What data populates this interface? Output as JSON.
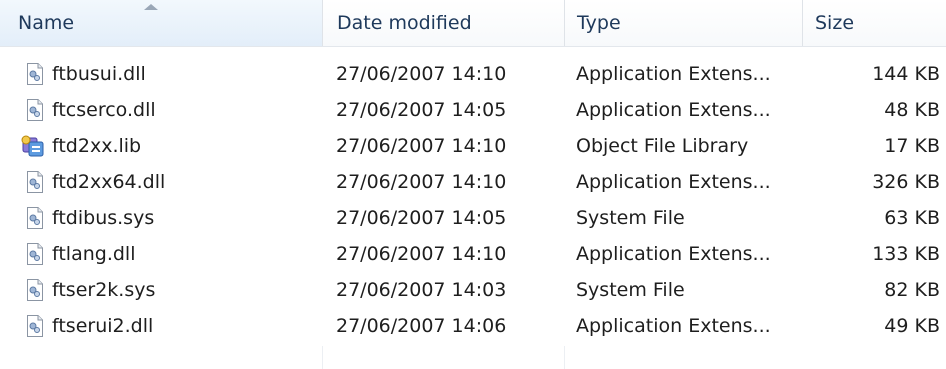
{
  "columns": {
    "name": "Name",
    "date": "Date modified",
    "type": "Type",
    "size": "Size"
  },
  "files": [
    {
      "name": "ftbusui.dll",
      "date": "27/06/2007 14:10",
      "type": "Application Extens...",
      "size": "144 KB",
      "icon": "dll-file-icon"
    },
    {
      "name": "ftcserco.dll",
      "date": "27/06/2007 14:05",
      "type": "Application Extens...",
      "size": "48 KB",
      "icon": "dll-file-icon"
    },
    {
      "name": "ftd2xx.lib",
      "date": "27/06/2007 14:10",
      "type": "Object File Library",
      "size": "17 KB",
      "icon": "lib-file-icon"
    },
    {
      "name": "ftd2xx64.dll",
      "date": "27/06/2007 14:10",
      "type": "Application Extens...",
      "size": "326 KB",
      "icon": "dll-file-icon"
    },
    {
      "name": "ftdibus.sys",
      "date": "27/06/2007 14:05",
      "type": "System File",
      "size": "63 KB",
      "icon": "sys-file-icon"
    },
    {
      "name": "ftlang.dll",
      "date": "27/06/2007 14:10",
      "type": "Application Extens...",
      "size": "133 KB",
      "icon": "dll-file-icon"
    },
    {
      "name": "ftser2k.sys",
      "date": "27/06/2007 14:03",
      "type": "System File",
      "size": "82 KB",
      "icon": "sys-file-icon"
    },
    {
      "name": "ftserui2.dll",
      "date": "27/06/2007 14:06",
      "type": "Application Extens...",
      "size": "49 KB",
      "icon": "dll-file-icon"
    }
  ],
  "colors": {
    "header_text": "#1e395b",
    "row_text": "#1e1e1e",
    "sorted_header_bg": "#e3eef9"
  }
}
